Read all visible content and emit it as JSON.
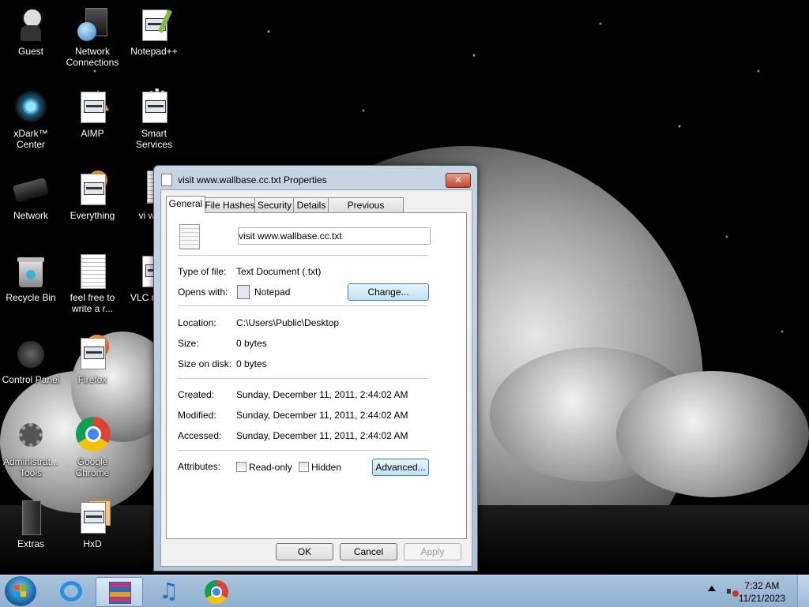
{
  "desktop_icons": [
    {
      "label": "Guest",
      "icon": "user-icon"
    },
    {
      "label": "Network Connections",
      "icon": "network-connections-icon"
    },
    {
      "label": "Notepad++",
      "icon": "notepad-plus-plus-icon"
    },
    {
      "label": "xDark™ Center",
      "icon": "xdark-center-icon"
    },
    {
      "label": "AIMP",
      "icon": "aimp-icon"
    },
    {
      "label": "Smart Services",
      "icon": "smart-services-icon"
    },
    {
      "label": "Network",
      "icon": "network-icon"
    },
    {
      "label": "Everything",
      "icon": "everything-icon"
    },
    {
      "label": "vi ww...",
      "icon": "text-file-icon"
    },
    {
      "label": "Recycle Bin",
      "icon": "recycle-bin-icon"
    },
    {
      "label": "feel free to write a r...",
      "icon": "text-document-icon"
    },
    {
      "label": "VLC r pla...",
      "icon": "vlc-icon"
    },
    {
      "label": "Control Panel",
      "icon": "control-panel-icon"
    },
    {
      "label": "Firefox",
      "icon": "firefox-icon"
    },
    {
      "label": "Administrat... Tools",
      "icon": "administrative-tools-icon"
    },
    {
      "label": "Google Chrome",
      "icon": "chrome-icon"
    },
    {
      "label": "Extras",
      "icon": "extras-icon"
    },
    {
      "label": "HxD",
      "icon": "hxd-icon"
    }
  ],
  "dialog": {
    "title": "visit www.wallbase.cc.txt Properties",
    "close_label": "✕",
    "tabs": [
      "General",
      "File Hashes",
      "Security",
      "Details",
      "Previous Versions"
    ],
    "active_tab": "General",
    "file_name": "visit www.wallbase.cc.txt",
    "type_label": "Type of file:",
    "type_value": "Text Document (.txt)",
    "opens_label": "Opens with:",
    "opens_value": "Notepad",
    "change_label": "Change...",
    "location_label": "Location:",
    "location_value": "C:\\Users\\Public\\Desktop",
    "size_label": "Size:",
    "size_value": "0 bytes",
    "size_on_disk_label": "Size on disk:",
    "size_on_disk_value": "0 bytes",
    "created_label": "Created:",
    "created_value": "Sunday, December 11, 2011, 2:44:02 AM",
    "modified_label": "Modified:",
    "modified_value": "Sunday, December 11, 2011, 2:44:02 AM",
    "accessed_label": "Accessed:",
    "accessed_value": "Sunday, December 11, 2011, 2:44:02 AM",
    "attributes_label": "Attributes:",
    "readonly_label": "Read-only",
    "hidden_label": "Hidden",
    "advanced_label": "Advanced...",
    "ok_label": "OK",
    "cancel_label": "Cancel",
    "apply_label": "Apply"
  },
  "taskbar": {
    "items": [
      "start-orb",
      "internet-explorer-icon",
      "winrar-icon",
      "music-player-icon",
      "chrome-icon"
    ],
    "time": "7:32 AM",
    "date": "11/21/2023"
  }
}
